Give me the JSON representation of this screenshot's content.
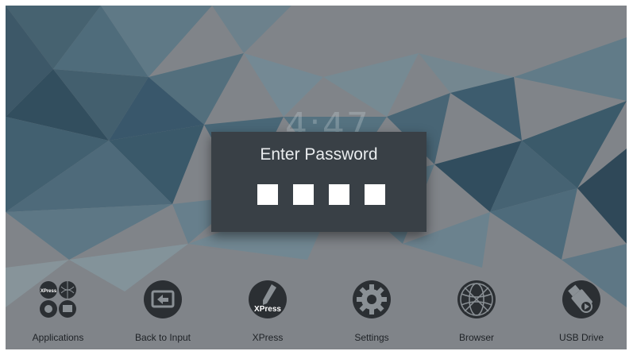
{
  "clock": {
    "time": "4:47"
  },
  "dialog": {
    "title": "Enter Password",
    "pin_digits": 4
  },
  "dock": {
    "items": [
      {
        "label": "Applications",
        "icon": "applications-grid-icon"
      },
      {
        "label": "Back to Input",
        "icon": "back-to-input-icon"
      },
      {
        "label": "XPress",
        "icon": "xpress-icon",
        "icon_text": "XPress"
      },
      {
        "label": "Settings",
        "icon": "settings-gear-icon"
      },
      {
        "label": "Browser",
        "icon": "browser-globe-icon"
      },
      {
        "label": "USB Drive",
        "icon": "usb-drive-icon"
      }
    ],
    "applications_icon_text": "XPress"
  },
  "colors": {
    "background": "#8f959a",
    "polygon_blue": "#3f6f86",
    "dialog": "#394046",
    "icon_fill": "#2b2f33",
    "pin_box": "#ffffff"
  }
}
